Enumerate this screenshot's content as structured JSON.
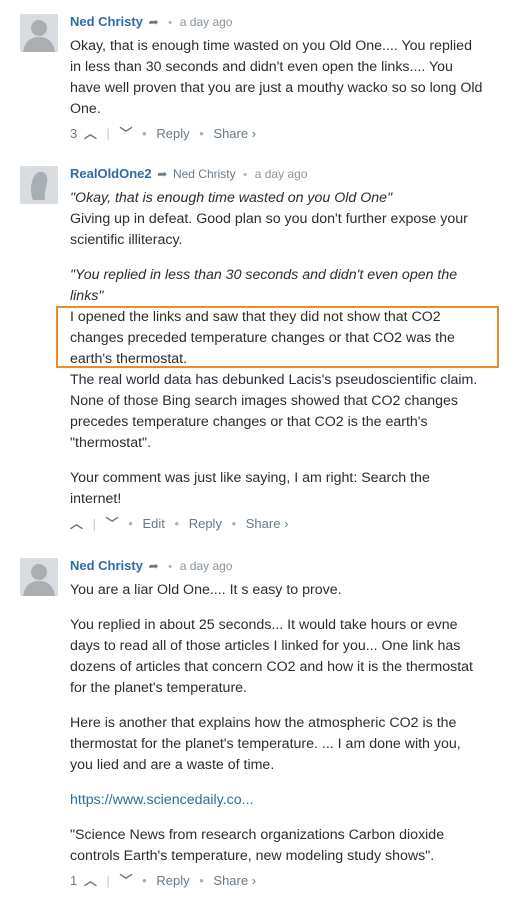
{
  "comments": [
    {
      "author": "Ned Christy",
      "parent": "",
      "time": "a day ago",
      "paragraphs": [
        "Okay, that is enough time wasted on you Old One.... You replied",
        "in less than 30 seconds and didn't even open the links.... You",
        "have well proven that you are just a mouthy wacko so so long Old",
        "One."
      ],
      "footer": {
        "votes": "3",
        "reply": "Reply",
        "share": "Share ›"
      }
    },
    {
      "author": "RealOldOne2",
      "parent": "Ned Christy",
      "time": "a day ago",
      "lines": [
        "\"Okay, that is enough time wasted on you Old One\"",
        "Giving up in defeat. Good plan so you don't further expose your",
        "scientific illiteracy.",
        "\"You replied in less than 30 seconds and didn't even open the",
        "links\"",
        "I opened the links and saw that they did not show that CO2",
        "changes preceded temperature changes or that CO2 was the",
        "earth's thermostat.",
        "The real world data has debunked Lacis's pseudoscientific claim.",
        "None of those Bing search images showed that CO2 changes",
        "precedes temperature changes or that CO2 is the earth's",
        "\"thermostat\".",
        "Your comment was just like saying, I am right: Search the",
        "internet!"
      ],
      "footer": {
        "votes": "",
        "edit": "Edit",
        "reply": "Reply",
        "share": "Share ›"
      }
    },
    {
      "author": "Ned Christy",
      "parent": "",
      "time": "a day ago",
      "lines": [
        "You are a liar Old One.... It s easy to prove.",
        "You replied in about 25 seconds... It would take hours or evne",
        "days to read all of those articles I linked for you... One link has",
        "dozens of articles that concern CO2 and how it is the thermostat",
        "for the planet's temperature.",
        "Here is another that explains how the atmospheric CO2 is the",
        "thermostat for the planet's temperature. ... I am done with you,",
        "you lied and are a waste of time.",
        "https://www.sciencedaily.co...",
        "\"Science News from research organizations Carbon dioxide",
        "controls Earth's temperature, new modeling study shows\"."
      ],
      "footer": {
        "votes": "1",
        "reply": "Reply",
        "share": "Share ›"
      }
    }
  ],
  "glyphs": {
    "reply_arrow": "➦",
    "up": "︿",
    "down": "﹀",
    "dot": "•",
    "vbar": "|"
  }
}
